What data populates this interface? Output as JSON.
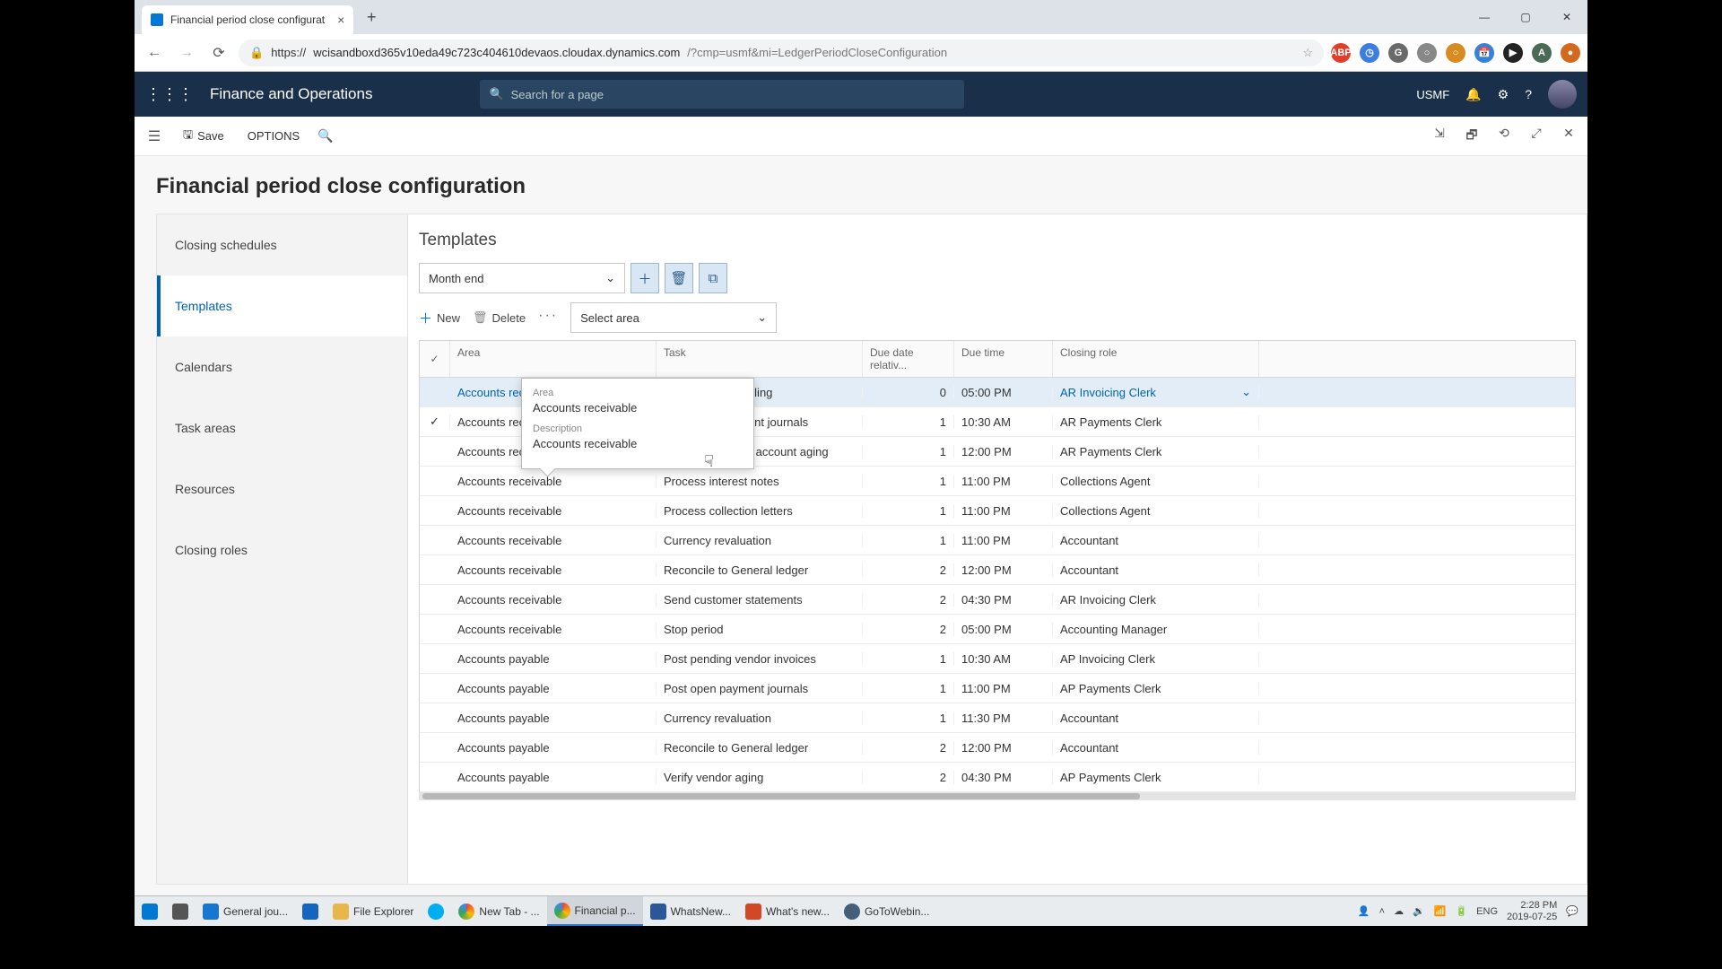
{
  "browser": {
    "tab_title": "Financial period close configurat",
    "url_host": "wcisandboxd365v10eda49c723c404610devaos.cloudax.dynamics.com",
    "url_path": "/?cmp=usmf&mi=LedgerPeriodCloseConfiguration",
    "url_scheme": "https://"
  },
  "header": {
    "app_title": "Finance and Operations",
    "search_placeholder": "Search for a page",
    "company": "USMF"
  },
  "action_bar": {
    "save": "Save",
    "options": "OPTIONS"
  },
  "page": {
    "title": "Financial period close configuration"
  },
  "left_nav": [
    "Closing schedules",
    "Templates",
    "Calendars",
    "Task areas",
    "Resources",
    "Closing roles"
  ],
  "panel": {
    "title": "Templates",
    "template_select": "Month end",
    "new_btn": "New",
    "delete_btn": "Delete",
    "area_select": "Select area"
  },
  "grid": {
    "headers": [
      "",
      "Area",
      "Task",
      "Due date relativ...",
      "Due time",
      "Closing role"
    ],
    "rows": [
      {
        "area": "Accounts receivable",
        "task": "Finalize period billing",
        "due": "0",
        "time": "05:00 PM",
        "role": "AR Invoicing Clerk",
        "sel": true
      },
      {
        "area": "Accounts receivable",
        "task": "Post open payment journals",
        "due": "1",
        "time": "10:30 AM",
        "role": "AR Payments Clerk",
        "chk": true
      },
      {
        "area": "Accounts receivable",
        "task": "Update customer account aging",
        "due": "1",
        "time": "12:00 PM",
        "role": "AR Payments Clerk"
      },
      {
        "area": "Accounts receivable",
        "task": "Process interest notes",
        "due": "1",
        "time": "11:00 PM",
        "role": "Collections Agent"
      },
      {
        "area": "Accounts receivable",
        "task": "Process collection letters",
        "due": "1",
        "time": "11:00 PM",
        "role": "Collections Agent"
      },
      {
        "area": "Accounts receivable",
        "task": "Currency revaluation",
        "due": "1",
        "time": "11:00 PM",
        "role": "Accountant"
      },
      {
        "area": "Accounts receivable",
        "task": "Reconcile to General ledger",
        "due": "2",
        "time": "12:00 PM",
        "role": "Accountant"
      },
      {
        "area": "Accounts receivable",
        "task": "Send customer statements",
        "due": "2",
        "time": "04:30 PM",
        "role": "AR Invoicing Clerk"
      },
      {
        "area": "Accounts receivable",
        "task": "Stop period",
        "due": "2",
        "time": "05:00 PM",
        "role": "Accounting Manager"
      },
      {
        "area": "Accounts payable",
        "task": "Post pending vendor invoices",
        "due": "1",
        "time": "10:30 AM",
        "role": "AP Invoicing Clerk"
      },
      {
        "area": "Accounts payable",
        "task": "Post open payment journals",
        "due": "1",
        "time": "11:00 PM",
        "role": "AP Payments Clerk"
      },
      {
        "area": "Accounts payable",
        "task": "Currency revaluation",
        "due": "1",
        "time": "11:30 PM",
        "role": "Accountant"
      },
      {
        "area": "Accounts payable",
        "task": "Reconcile to General ledger",
        "due": "2",
        "time": "12:00 PM",
        "role": "Accountant"
      },
      {
        "area": "Accounts payable",
        "task": "Verify vendor aging",
        "due": "2",
        "time": "04:30 PM",
        "role": "AP Payments Clerk"
      }
    ]
  },
  "popover": {
    "area_label": "Area",
    "area_value": "Accounts receivable",
    "desc_label": "Description",
    "desc_value": "Accounts receivable"
  },
  "taskbar": {
    "items": [
      "General jou...",
      "",
      "File Explorer",
      "",
      "New Tab - ...",
      "Financial p...",
      "WhatsNew...",
      "What's new...",
      "GoToWebin..."
    ],
    "lang": "ENG",
    "time": "2:28 PM",
    "date": "2019-07-25"
  }
}
